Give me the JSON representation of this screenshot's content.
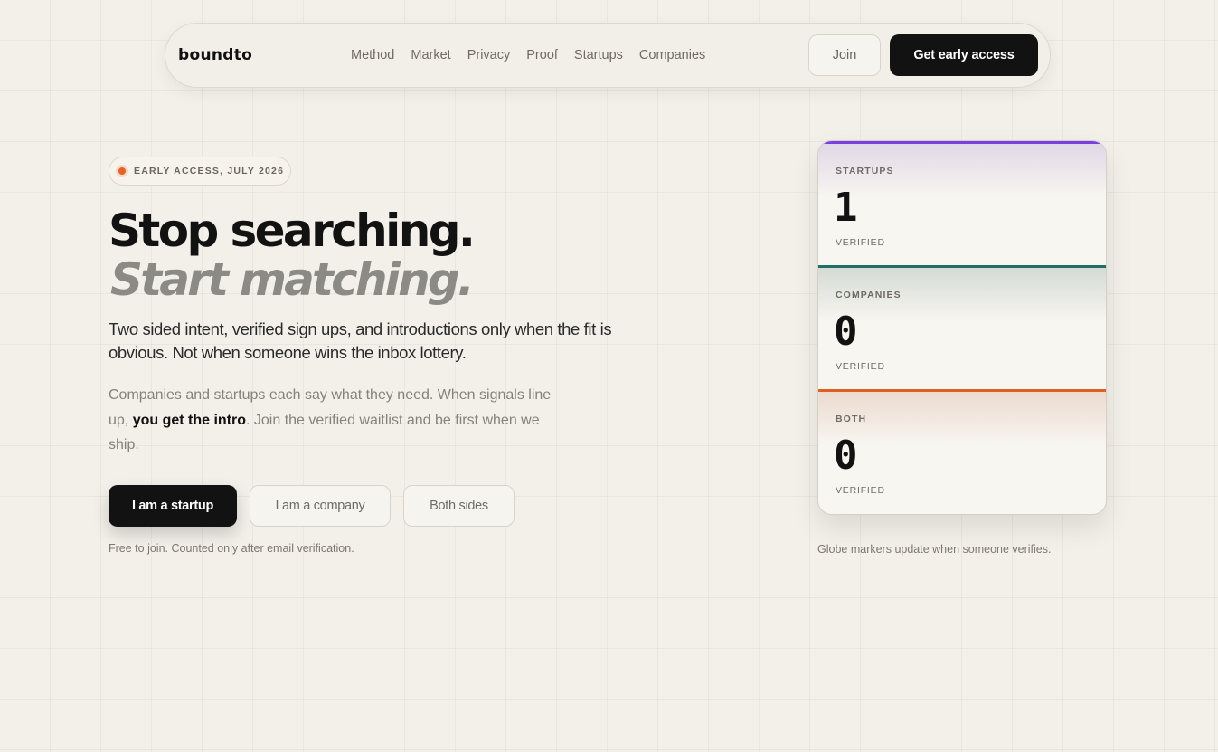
{
  "nav": {
    "brand": "boundto",
    "links": [
      "Method",
      "Market",
      "Privacy",
      "Proof",
      "Startups",
      "Companies"
    ],
    "join_label": "Join",
    "access_label": "Get early access"
  },
  "hero": {
    "badge": "EARLY ACCESS, JULY 2026",
    "title_line1": "Stop searching.",
    "title_line2": "Start matching.",
    "lead": "Two sided intent, verified sign ups, and introductions only when the fit is obvious. Not when someone wins the inbox lottery.",
    "body_part1": "Companies and startups each say what they need. When signals line up, ",
    "body_emphasis": "you get the intro",
    "body_part2": ". Join the verified waitlist and be first when we ship.",
    "cta_startup": "I am a startup",
    "cta_company": "I am a company",
    "cta_both": "Both sides",
    "cta_note": "Free to join. Counted only after email verification."
  },
  "stats": {
    "items": [
      {
        "label": "STARTUPS",
        "value": "1",
        "sub": "VERIFIED"
      },
      {
        "label": "COMPANIES",
        "value": "0",
        "sub": "VERIFIED"
      },
      {
        "label": "BOTH",
        "value": "0",
        "sub": "VERIFIED"
      }
    ],
    "note": "Globe markers update when someone verifies."
  },
  "colors": {
    "accent_startups": "#7a3fe0",
    "accent_companies": "#1f6f66",
    "accent_both": "#e0601f",
    "badge_dot": "#e4612a"
  }
}
